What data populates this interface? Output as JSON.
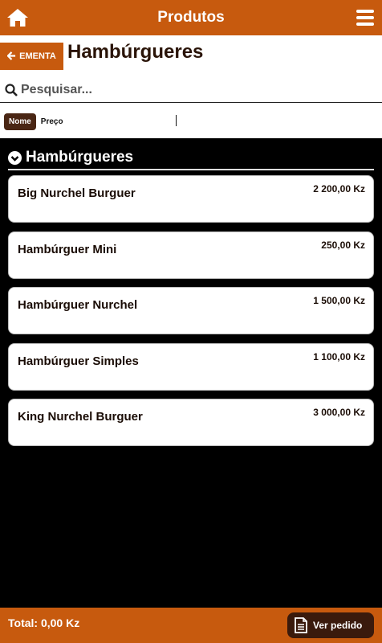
{
  "header": {
    "title": "Produtos",
    "home_icon": "home-icon",
    "menu_icon": "menu-icon",
    "accent_color": "#c75a0e"
  },
  "category": {
    "back_label": "EMENTA",
    "back_icon": "arrow-left-icon",
    "title": "Hambúrgueres"
  },
  "search": {
    "placeholder": "Pesquisar...",
    "value": ""
  },
  "sort": {
    "options": [
      "Nome",
      "Preço"
    ],
    "selected": "Nome"
  },
  "section": {
    "title": "Hambúrgueres",
    "icon": "chevron-down-circle-icon"
  },
  "products": [
    {
      "name": "Big Nurchel Burguer",
      "price": "2 200,00 Kz"
    },
    {
      "name": "Hambúrguer Mini",
      "price": "250,00 Kz"
    },
    {
      "name": "Hambúrguer Nurchel",
      "price": "1 500,00 Kz"
    },
    {
      "name": "Hambúrguer Simples",
      "price": "1 100,00 Kz"
    },
    {
      "name": "King Nurchel Burguer",
      "price": "3 000,00 Kz"
    }
  ],
  "footer": {
    "total": "Total: 0,00 Kz",
    "order_button": "Ver pedido",
    "order_icon": "document-icon"
  }
}
